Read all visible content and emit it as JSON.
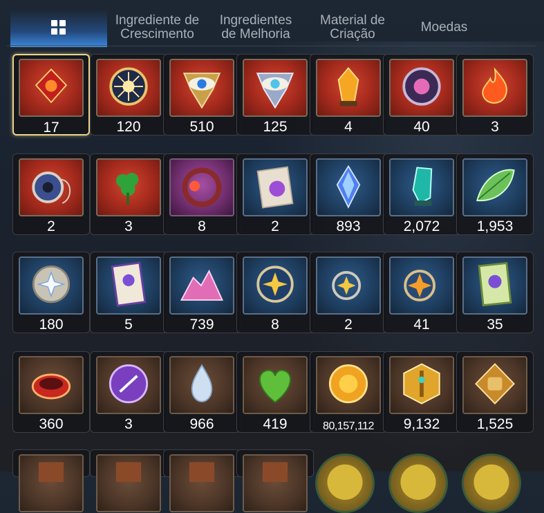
{
  "tabs": [
    {
      "label": "",
      "icon": "grid-icon",
      "active": true
    },
    {
      "label": "Ingrediente de Crescimento"
    },
    {
      "label": "Ingredientes de Melhoria"
    },
    {
      "label": "Material de Criação"
    },
    {
      "label": "Moedas"
    }
  ],
  "items": [
    {
      "qty": "17",
      "bg": "red",
      "icon": "red-crystal-icon",
      "selected": true
    },
    {
      "qty": "120",
      "bg": "red",
      "icon": "sun-medallion-icon"
    },
    {
      "qty": "510",
      "bg": "red",
      "icon": "gold-eye-emblem-icon"
    },
    {
      "qty": "125",
      "bg": "red",
      "icon": "silver-eye-emblem-icon"
    },
    {
      "qty": "4",
      "bg": "red",
      "icon": "gold-crystal-icon"
    },
    {
      "qty": "40",
      "bg": "red",
      "icon": "pink-charm-icon"
    },
    {
      "qty": "3",
      "bg": "red",
      "icon": "flame-charm-icon"
    },
    {
      "qty": "2",
      "bg": "red",
      "icon": "blue-ring-pendant-icon"
    },
    {
      "qty": "3",
      "bg": "red",
      "icon": "clover-pendant-icon"
    },
    {
      "qty": "8",
      "bg": "purple",
      "icon": "red-flower-ring-icon"
    },
    {
      "qty": "2",
      "bg": "blue",
      "icon": "stamp-card-icon"
    },
    {
      "qty": "893",
      "bg": "blue",
      "icon": "blue-gem-icon"
    },
    {
      "qty": "2,072",
      "bg": "blue",
      "icon": "teal-crystal-icon"
    },
    {
      "qty": "1,953",
      "bg": "blue",
      "icon": "green-leaf-icon"
    },
    {
      "qty": "180",
      "bg": "blue",
      "icon": "star-coin-icon"
    },
    {
      "qty": "5",
      "bg": "blue",
      "icon": "purple-certificate-icon"
    },
    {
      "qty": "739",
      "bg": "blue",
      "icon": "pink-crystal-pile-icon"
    },
    {
      "qty": "8",
      "bg": "blue",
      "icon": "star-medallion-icon"
    },
    {
      "qty": "2",
      "bg": "blue",
      "icon": "star-pendant-icon"
    },
    {
      "qty": "41",
      "bg": "blue",
      "icon": "orange-star-pendant-icon"
    },
    {
      "qty": "35",
      "bg": "blue",
      "icon": "green-card-icon"
    },
    {
      "qty": "360",
      "bg": "brown",
      "icon": "red-bracelet-icon"
    },
    {
      "qty": "3",
      "bg": "brown",
      "icon": "purple-seal-icon"
    },
    {
      "qty": "966",
      "bg": "brown",
      "icon": "silver-drop-icon"
    },
    {
      "qty": "419",
      "bg": "brown",
      "icon": "green-heart-icon"
    },
    {
      "qty": "80,157,112",
      "bg": "brown",
      "icon": "gold-coin-icon",
      "small": true
    },
    {
      "qty": "9,132",
      "bg": "brown",
      "icon": "gold-sword-badge-icon"
    },
    {
      "qty": "1,525",
      "bg": "brown",
      "icon": "fist-badge-icon"
    },
    {
      "qty": "",
      "bg": "brown",
      "icon": "partial-item-icon"
    },
    {
      "qty": "",
      "bg": "brown",
      "icon": "partial-item-icon"
    },
    {
      "qty": "",
      "bg": "brown",
      "icon": "partial-item-icon"
    },
    {
      "qty": "",
      "bg": "brown",
      "icon": "partial-item-icon"
    },
    {
      "qty": "",
      "bg": "round",
      "icon": "round-portrait-icon"
    },
    {
      "qty": "",
      "bg": "round",
      "icon": "round-portrait-icon"
    },
    {
      "qty": "",
      "bg": "round",
      "icon": "round-portrait-icon"
    }
  ]
}
